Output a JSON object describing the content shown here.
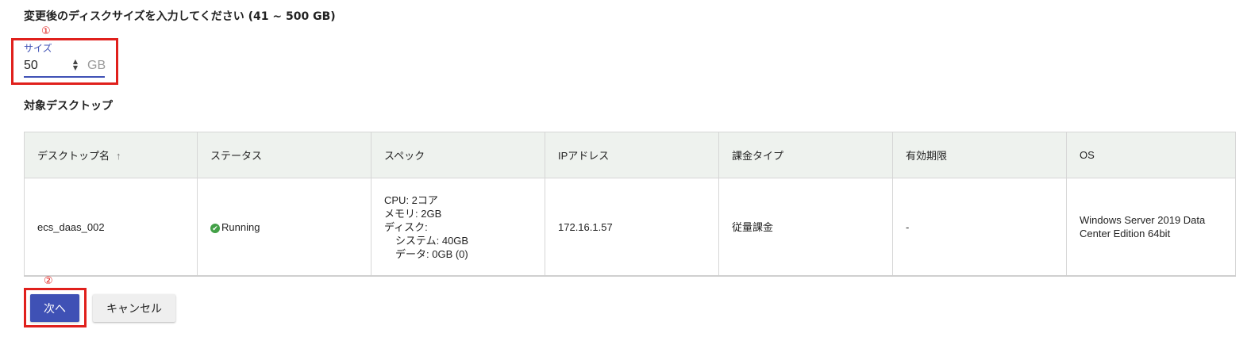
{
  "form": {
    "heading": "変更後のディスクサイズを入力してください (41 ~ 500 GB)",
    "size_label": "サイズ",
    "size_value": "50",
    "size_unit": "GB"
  },
  "annotations": {
    "marker1": "①",
    "marker2": "②",
    "color": "#e0201c"
  },
  "section": {
    "title": "対象デスクトップ"
  },
  "table": {
    "headers": [
      "デスクトップ名",
      "ステータス",
      "スペック",
      "IPアドレス",
      "課金タイプ",
      "有効期限",
      "OS"
    ],
    "sort_indicator": "↑",
    "rows": [
      {
        "name": "ecs_daas_002",
        "status": "Running",
        "spec": {
          "cpu": "CPU: 2コア",
          "memory": "メモリ: 2GB",
          "disk": "ディスク:",
          "system": "システム: 40GB",
          "data": "データ: 0GB (0)"
        },
        "ip": "172.16.1.57",
        "billing": "従量課金",
        "expiry": "-",
        "os_line1": "Windows Server 2019 Data",
        "os_line2": "Center Edition 64bit"
      }
    ]
  },
  "buttons": {
    "next": "次へ",
    "cancel": "キャンセル"
  },
  "colors": {
    "accent": "#3f51b5",
    "status_ok": "#43a047",
    "header_bg": "#eef2ee"
  },
  "icons": {
    "status": "check-circle-icon",
    "sort": "arrow-up-icon",
    "spinner": "spinner-arrows-icon"
  }
}
